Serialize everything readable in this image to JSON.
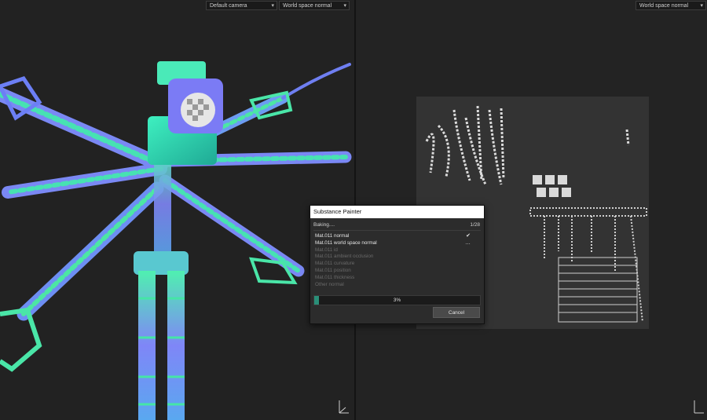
{
  "viewport3d": {
    "camera_dropdown": "Default camera",
    "mode_dropdown": "World space normal"
  },
  "viewport2d": {
    "mode_dropdown": "World space normal"
  },
  "dialog": {
    "title": "Substance Painter",
    "status": "Baking....",
    "counter": "1/28",
    "tasks": [
      {
        "label": "Mat.011 normal",
        "state": "done",
        "mark": "✔"
      },
      {
        "label": "Mat.011 world space normal",
        "state": "active",
        "mark": "…"
      },
      {
        "label": "Mat.011 id",
        "state": "pending"
      },
      {
        "label": "Mat.011 ambient occlusion",
        "state": "pending"
      },
      {
        "label": "Mat.011 curvature",
        "state": "pending"
      },
      {
        "label": "Mat.011 position",
        "state": "pending"
      },
      {
        "label": "Mat.011 thickness",
        "state": "pending"
      },
      {
        "label": "Other normal",
        "state": "pending"
      }
    ],
    "progress_value": 3,
    "progress_label": "3%",
    "cancel_label": "Cancel"
  },
  "colors": {
    "progress_fill": "#2a8f78",
    "normal_blue": "#7b7bf5",
    "normal_green": "#43e6a0",
    "normal_teal": "#2fd6c8"
  },
  "icons": [
    "chevron-down-icon",
    "checkmark-icon",
    "axis-gizmo-icon"
  ]
}
